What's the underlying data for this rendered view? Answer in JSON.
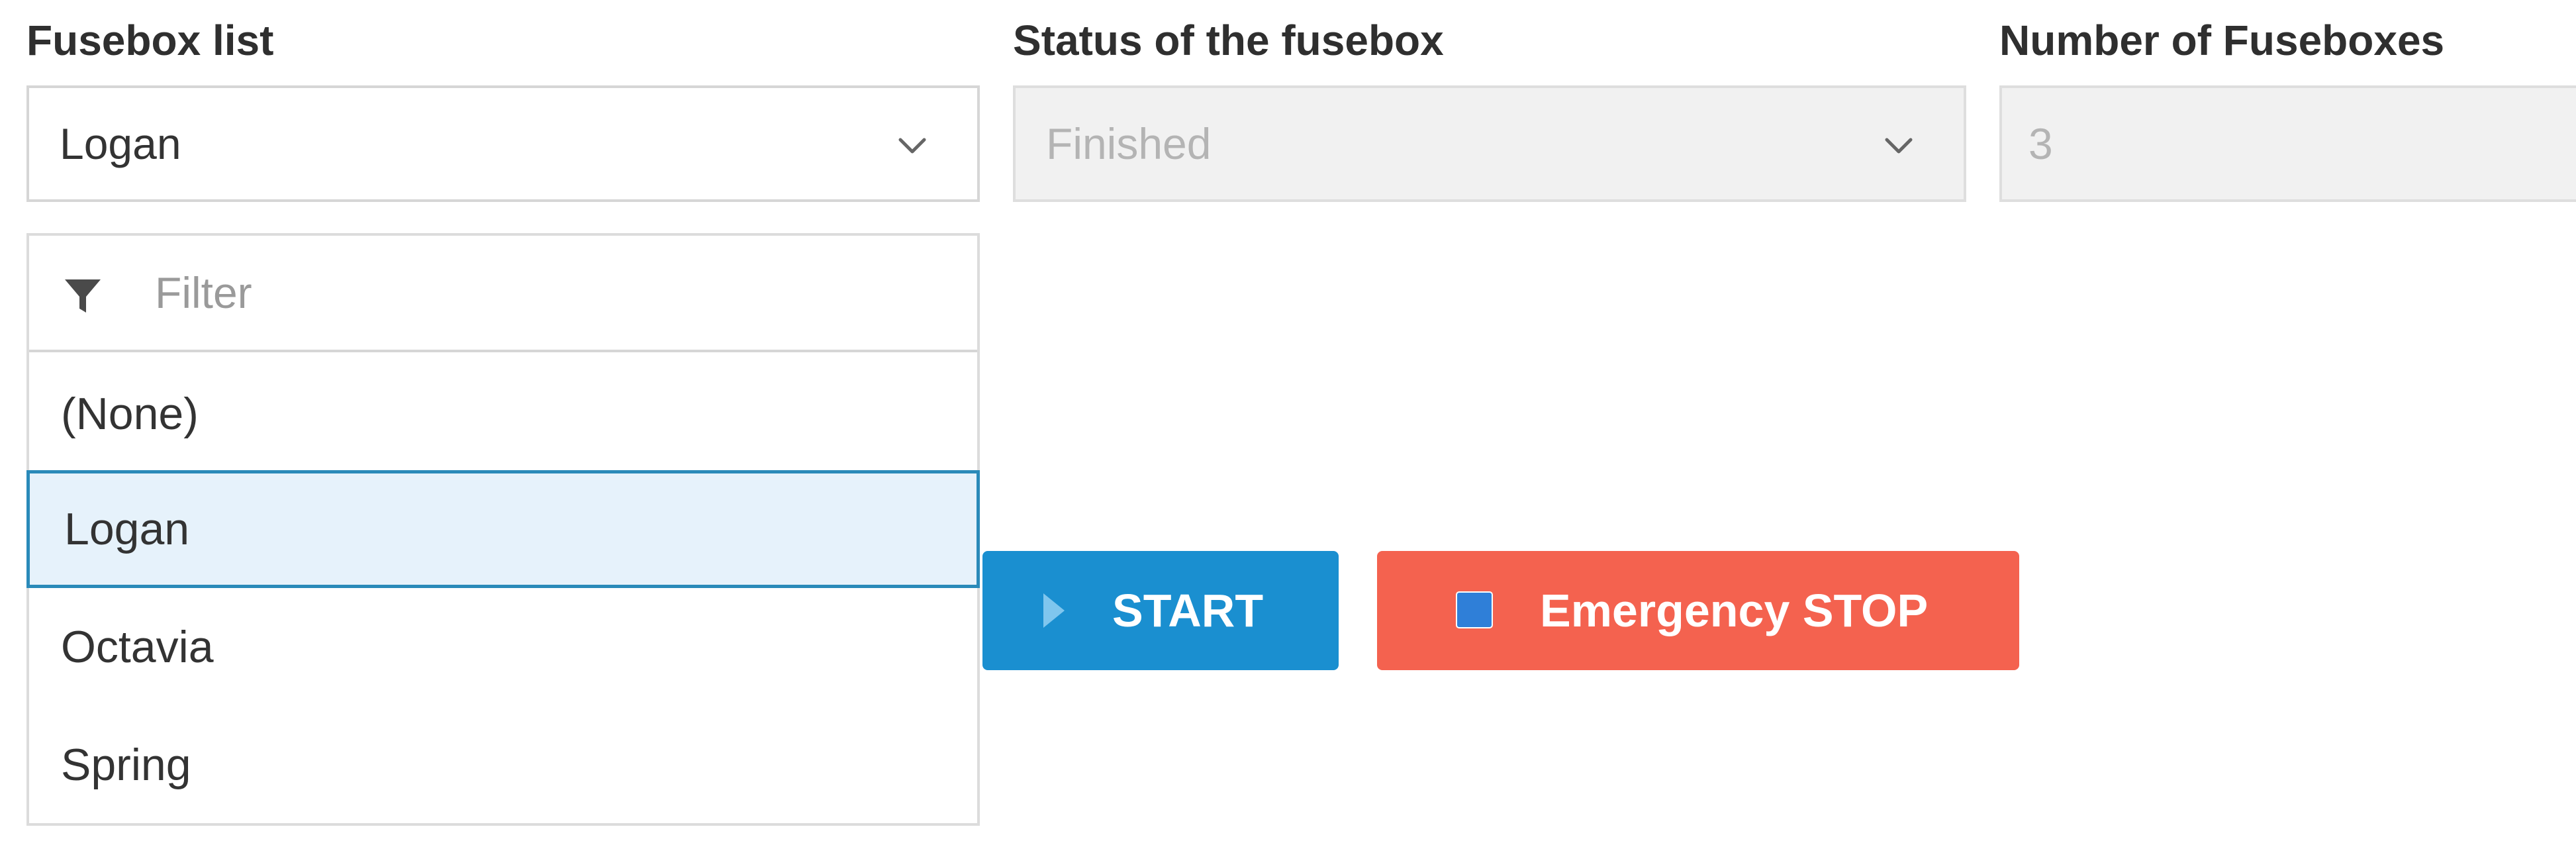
{
  "fields": {
    "fusebox_list": {
      "label": "Fusebox list",
      "value": "Logan"
    },
    "status": {
      "label": "Status of the fusebox",
      "value": "Finished",
      "disabled": true
    },
    "count": {
      "label": "Number of Fuseboxes",
      "value": "3",
      "disabled": true
    }
  },
  "dropdown": {
    "filter_placeholder": "Filter",
    "options": [
      "(None)",
      "Logan",
      "Octavia",
      "Spring"
    ],
    "selected": "Logan"
  },
  "buttons": {
    "start_label": "START",
    "stop_label": "Emergency STOP"
  },
  "colors": {
    "start_bg": "#1a8fd0",
    "stop_bg": "#f4624f",
    "selected_bg": "#e6f2fb",
    "selected_border": "#2a8ab9"
  },
  "icons": {
    "chevron": "chevron-down-icon",
    "filter": "filter-icon",
    "play": "play-icon",
    "stop": "stop-icon"
  }
}
